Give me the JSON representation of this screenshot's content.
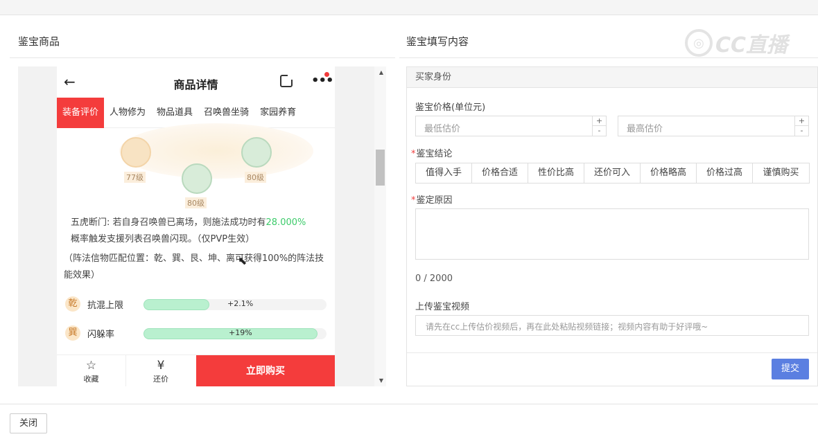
{
  "left": {
    "title": "鉴宝商品"
  },
  "right": {
    "title": "鉴宝填写内容",
    "watermark": "CC直播"
  },
  "phone": {
    "nav_title": "商品详情",
    "back_icon": "arrow-left-icon",
    "tabs": [
      "装备评价",
      "人物修为",
      "物品道具",
      "召唤兽坐骑",
      "家园养育"
    ],
    "art": {
      "level_left": "77级",
      "level_center": "80级",
      "level_right": "80级"
    },
    "desc": {
      "line1_prefix": "五虎断门: 若自身召唤兽已离场，则施法成功时有",
      "line1_highlight": "28.000%",
      "line2": "概率触发支援列表召唤兽闪现。（仅PVP生效）",
      "formation": "（阵法信物匹配位置：乾、巽、艮、坤、离可获得100%的阵法技能效果）"
    },
    "stats": [
      {
        "symbol": "乾",
        "name": "抗混上限",
        "value": "+2.1%",
        "fill": 0.36
      },
      {
        "symbol": "巽",
        "name": "闪躲率",
        "value": "+19%",
        "fill": 0.95
      }
    ],
    "bottom": {
      "fav": "收藏",
      "bargain": "还价",
      "buy": "立即购买"
    }
  },
  "form": {
    "section": "买家身份",
    "price_label": "鉴宝价格(单位元)",
    "min_placeholder": "最低估价",
    "max_placeholder": "最高估价",
    "conclusion_label": "鉴宝结论",
    "conclusions": [
      "值得入手",
      "价格合适",
      "性价比高",
      "还价可入",
      "价格略高",
      "价格过高",
      "谨慎购买"
    ],
    "reason_label": "鉴定原因",
    "counter": "0 / 2000",
    "video_label": "上传鉴宝视频",
    "video_placeholder": "请先在cc上传估价视频后，再在此处粘贴视频链接；视频内容有助于好评哦~",
    "submit": "提交"
  },
  "footer": {
    "close": "关闭"
  }
}
